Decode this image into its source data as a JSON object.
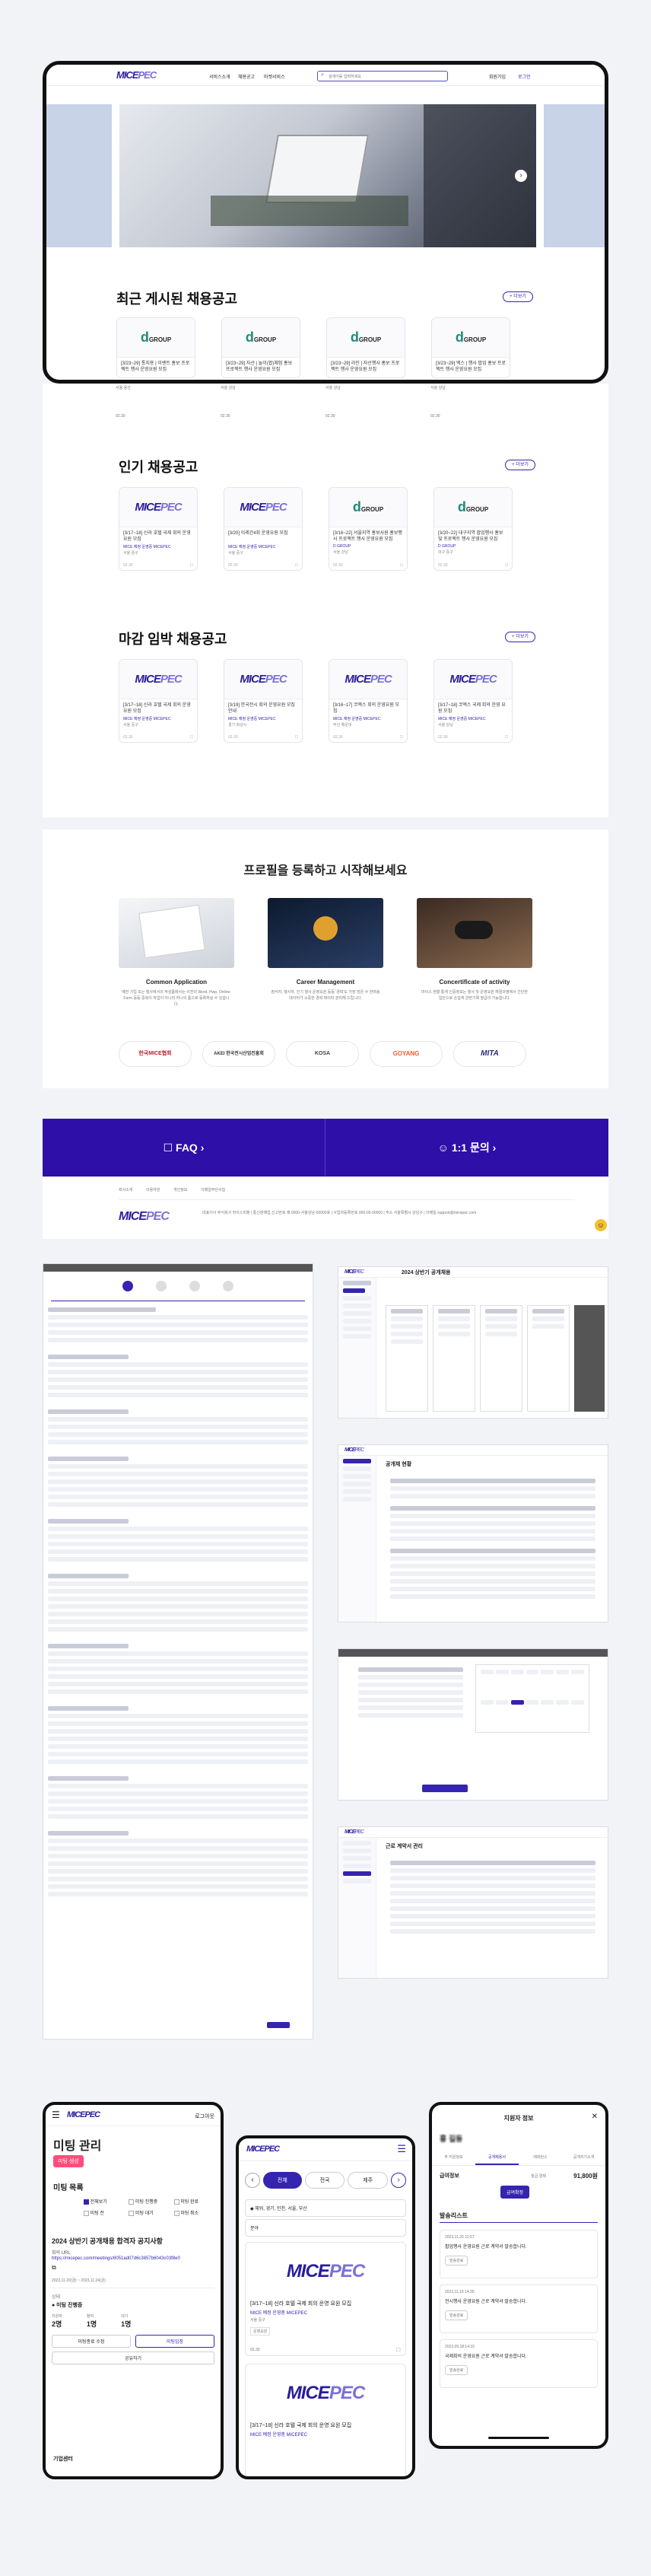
{
  "header": {
    "nav": [
      "서비스소개",
      "채용공고",
      "마켓서비스"
    ],
    "search_placeholder": "검색어를 입력하세요",
    "signup": "회원가입",
    "login": "로그인"
  },
  "sections": {
    "recent": {
      "title": "최근 게시된 채용공고",
      "more": "+ 더보기"
    },
    "popular": {
      "title": "인기 채용공고",
      "more": "+ 더보기"
    },
    "deadline": {
      "title": "마감 임박 채용공고",
      "more": "+ 더보기"
    }
  },
  "recent_cards": [
    {
      "title": "[3/23~29] 통지용 | 이벤트 홍보 프로젝트 행사 운영요원 모집",
      "company": "D GROUP",
      "loc": "서울 용산",
      "date": "02.30"
    },
    {
      "title": "[3/23~29] 자선 | 놀이(팝)체험 홍보 프로젝트 행사 운영요원 모집",
      "company": "D GROUP",
      "loc": "서울 강남",
      "date": "02.30"
    },
    {
      "title": "[3/23~29] 라인 | 자선행사 홍보 프로젝트 행사 운영요원 모집",
      "company": "D GROUP",
      "loc": "서울 강남",
      "date": "02.30"
    },
    {
      "title": "[3/23~29] 엑스 | 행사 팝업 홍보 프로젝트 행사 운영요원 모집",
      "company": "D GROUP",
      "loc": "서울 강남",
      "date": "02.30"
    }
  ],
  "popular_cards": [
    {
      "title": "[3/17~18] 신라 호텔 국제 회의 운영 요원 모집",
      "company": "MICE 예정 운영중 MICEPEC",
      "loc": "서울 중구",
      "date": "02.30"
    },
    {
      "title": "[3/20] 이레간4회 운영요원 모집",
      "company": "MICE 예정 운영중 MICEPEC",
      "loc": "서울 중구",
      "date": "02.30"
    },
    {
      "title": "[3/16~22] 서울지역 홍보사원 홍보행사 프로젝트 행사 운영요원 모집",
      "company": "D GROUP",
      "loc": "서울 강남",
      "date": "02.30"
    },
    {
      "title": "[3/20~22] 대구지역 팝업행사 홍보 및 프로젝트 행사 운영요원 모집",
      "company": "D GROUP",
      "loc": "대구 중구",
      "date": "02.30"
    }
  ],
  "deadline_cards": [
    {
      "title": "[3/17~18] 신라 호텔 국제 회의 운영 요원 모집",
      "company": "MICE 예정 운영중 MICEPEC",
      "loc": "서울 중구",
      "date": "02.30"
    },
    {
      "title": "[3/19] 한국전시 회의 운영요원 모집 안내",
      "company": "MICE 예정 운영중 MICEPEC",
      "loc": "경기 화성시",
      "date": "02.30"
    },
    {
      "title": "[3/16~17] 코엑스 회의 운영요원 모집",
      "company": "MICE 예정 운영중 MICEPEC",
      "loc": "부산 해운대",
      "date": "02.30"
    },
    {
      "title": "[3/17~18] 코엑스 국제 회의 운영 요원 모집",
      "company": "MICE 예정 운영중 MICEPEC",
      "loc": "서울 강남",
      "date": "02.30"
    }
  ],
  "profile": {
    "title": "프로필을 등록하고 시작해보세요",
    "items": [
      {
        "name": "Common Application",
        "desc": "예전 기업 또는 행사에서의 작성폼에서는 이전의 Word, Hwp, Online-Form 등등 중복이 작업이 아니라 하나의 폼으로 등록하실 수 있습니다."
      },
      {
        "name": "Career Management",
        "desc": "참석자, 행사자, 인기 행사 운영요원 등등 '경력'도 가장 많은 수 한마음 데이터가 소중한 경력 데이터 관리해 드립니다."
      },
      {
        "name": "Concertificate of activity",
        "desc": "마이스 현황 통계 인증정보는 행사 및 운영요원 해결과정에서 간단한 입단으로 손쉽게 관련기록 발급이 가능합니다."
      }
    ]
  },
  "partners": [
    "한국MICE협회",
    "AKEI 한국전시산업진흥회",
    "KOSA",
    "GOYANG",
    "MITA"
  ],
  "cta": {
    "faq": "FAQ",
    "inquiry": "1:1 문의"
  },
  "footer": {
    "links": [
      "회사소개",
      "이용약관",
      "개인정보",
      "이메일무단수집"
    ],
    "logo": "MICEPEC",
    "info": "대표이사 주식회사 마이스피플 | 통신판매업 신고번호 제 0000-서울강남-00000호 | 사업자등록번호 000-00-00000 | 주소 서울특별시 강남구 | 이메일 support@micepec.com"
  },
  "desk_shots": {
    "meeting_title": "2024 상반기 공개채용",
    "applicant_title": "공개채 현황",
    "manage_title": "근로 계약서 관리"
  },
  "mobile1": {
    "logo": "MICEPEC",
    "user": "로그아웃",
    "title": "미팅 관리",
    "create": "미팅 생성",
    "sub": "미팅 목록",
    "filters": [
      "전체보기",
      "미팅 진행중",
      "미팅 완료",
      "미팅 전",
      "미팅 대기",
      "미팅 취소"
    ],
    "meeting_name": "2024 상반기 공개채용 합격자 공지사항",
    "link_label": "회의 URL",
    "link": "https://micepec.com/meetings/8051ad07d6c3857b6043c03f8e0",
    "date_label": "2023.11.20(금) ~ 2023.11.24(금)",
    "status_label": "상태",
    "status": "● 미팅 진행중",
    "stats_labels": [
      "지원자",
      "참여",
      "대기"
    ],
    "stats": [
      "2명",
      "1명",
      "1명"
    ],
    "btn1": "미팅종료 수정",
    "btn2": "미팅입장",
    "btn3": "공유하기",
    "footer": "기업센터"
  },
  "mobile2": {
    "logo": "MICEPEC",
    "tabs": [
      "전체",
      "전국",
      "제주"
    ],
    "filter1": "◆ 채워, 경기, 인천, 서울, 부산",
    "filter2": "분야",
    "card1_title": "[3/17~18] 신라 호텔 국제 회의 운영 요원 모집",
    "card1_company": "MICE 예정 운영중 MICEPEC",
    "card1_loc": "서울 중구",
    "card1_tag": "운영요원",
    "card1_date": "02.30",
    "card2_title": "[3/17~18] 신라 호텔 국제 회의 운영 요원 모집",
    "card2_company": "MICE 예정 운영중 MICEPEC"
  },
  "mobile3": {
    "title": "지원자 정보",
    "name": "홍 길동",
    "tabs": [
      "주 지원정보",
      "공개채용서",
      "레퍼런스",
      "공개자기소개"
    ],
    "wage_label": "급여정보",
    "wage_note": "월급 결제",
    "wage": "91,800원",
    "confirm": "급여확정",
    "list_title": "발송리스트",
    "entries": [
      {
        "date": "2023.11.20 12:57",
        "text": "팝업행사 운영요원 근로 계약서 발송합니다.",
        "btn": "발송완료"
      },
      {
        "date": "2023.11.19 14:30",
        "text": "전시행사 운영요원 근로 계약서 발송합니다.",
        "btn": "발송완료"
      },
      {
        "date": "2023.09.18 14:15",
        "text": "국제회의 운영요원 근로 계약서 발송합니다.",
        "btn": "발송완료"
      }
    ]
  },
  "colors": {
    "brand": "#3524b0",
    "accent": "#ff4d7a",
    "cta_bg": "#2e0fa8"
  }
}
